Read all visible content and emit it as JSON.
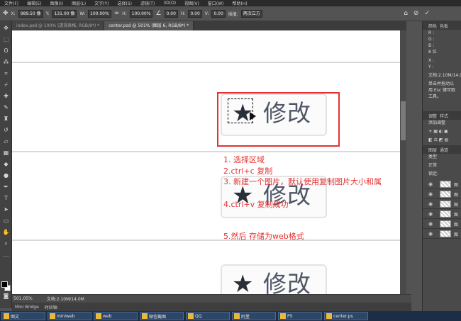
{
  "menu": [
    "文件(F)",
    "编辑(E)",
    "图像(I)",
    "图层(L)",
    "文字(Y)",
    "选择(S)",
    "滤镜(T)",
    "3D(D)",
    "视图(V)",
    "窗口(W)",
    "帮助(H)"
  ],
  "options": {
    "x": "989.50 像",
    "y": "131.00 像",
    "w": "100.00%",
    "h": "100.00%",
    "angle": "0.00",
    "hskew": "0.00",
    "vskew": "0.00",
    "interp_label": "插值:",
    "interp_value": "两次立方"
  },
  "tabs": [
    {
      "label": "index.psd @ 100% (透视表格, RGB/8*) *",
      "active": false
    },
    {
      "label": "center.psd @ 501% (图层 6, RGB/8*) *",
      "active": true
    }
  ],
  "canvas": {
    "button_text": "修改",
    "star_glyph": "★"
  },
  "notes": {
    "n1": "1. 选择区域",
    "n2": "2.ctrl+c 复制",
    "n3": "3. 新建一个图片，默认使用复制图片大小和属",
    "n4": "4.ctrl+v 复制成功",
    "n5": "5.然后 存储为web格式"
  },
  "status": {
    "zoom": "501.05%",
    "doc": "文档:2.10M/14.0M"
  },
  "minibridge": {
    "label": "Mini Bridge",
    "timeline": "时间轴"
  },
  "panels": {
    "info_tabs": [
      "颜色",
      "色板"
    ],
    "r": "R :",
    "g": "G :",
    "b": "B :",
    "bit": "8 位",
    "xlabel": "X :",
    "ylabel": "Y :",
    "doc": "文档:2.10M/14.0M",
    "hint1": "单击并拖动以",
    "hint2": "用 Esc 键可取",
    "hint3": "工具。",
    "adj_tabs": [
      "调整",
      "样式"
    ],
    "adj_label": "添加调整",
    "layer_tabs": [
      "图层",
      "通道"
    ],
    "kind": "类型",
    "mode": "正常",
    "lock": "锁定:",
    "layers": [
      "图",
      "图",
      "图",
      "图",
      "图",
      "图"
    ]
  },
  "taskbar": [
    {
      "label": "图文"
    },
    {
      "label": "miniweb"
    },
    {
      "label": "web"
    },
    {
      "label": "微信截图"
    },
    {
      "label": "QQ"
    },
    {
      "label": "阿里"
    },
    {
      "label": "PS"
    },
    {
      "label": "center.ps"
    }
  ],
  "colors": {
    "annotation": "#e23232",
    "canvas_bg": "#ffffff",
    "ps_bg": "#535353"
  }
}
